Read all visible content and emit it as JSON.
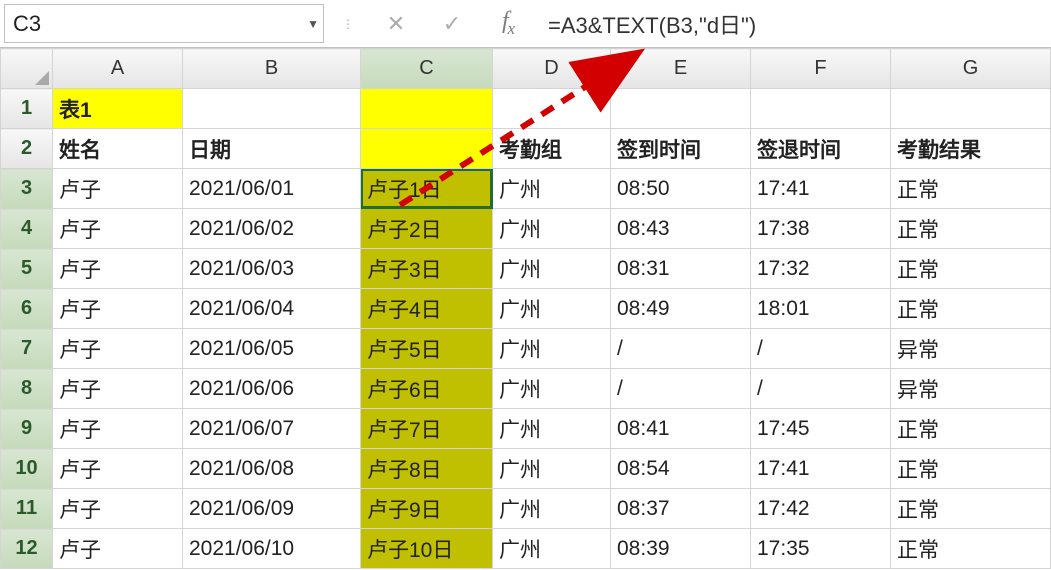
{
  "name_box": "C3",
  "formula": "=A3&TEXT(B3,\"d日\")",
  "col_headers": [
    "A",
    "B",
    "C",
    "D",
    "E",
    "F",
    "G"
  ],
  "selected_col_index": 2,
  "selected_row_indices": [
    3,
    4,
    5,
    6,
    7,
    8,
    9,
    10,
    11,
    12
  ],
  "rows": [
    {
      "n": 1,
      "cells": [
        "表1",
        "",
        "",
        "",
        "",
        "",
        ""
      ]
    },
    {
      "n": 2,
      "cells": [
        "姓名",
        "日期",
        "",
        "考勤组",
        "签到时间",
        "签退时间",
        "考勤结果"
      ]
    },
    {
      "n": 3,
      "cells": [
        "卢子",
        "2021/06/01",
        "卢子1日",
        "广州",
        "08:50",
        "17:41",
        "正常"
      ]
    },
    {
      "n": 4,
      "cells": [
        "卢子",
        "2021/06/02",
        "卢子2日",
        "广州",
        "08:43",
        "17:38",
        "正常"
      ]
    },
    {
      "n": 5,
      "cells": [
        "卢子",
        "2021/06/03",
        "卢子3日",
        "广州",
        "08:31",
        "17:32",
        "正常"
      ]
    },
    {
      "n": 6,
      "cells": [
        "卢子",
        "2021/06/04",
        "卢子4日",
        "广州",
        "08:49",
        "18:01",
        "正常"
      ]
    },
    {
      "n": 7,
      "cells": [
        "卢子",
        "2021/06/05",
        "卢子5日",
        "广州",
        "/",
        "/",
        "异常"
      ]
    },
    {
      "n": 8,
      "cells": [
        "卢子",
        "2021/06/06",
        "卢子6日",
        "广州",
        "/",
        "/",
        "异常"
      ]
    },
    {
      "n": 9,
      "cells": [
        "卢子",
        "2021/06/07",
        "卢子7日",
        "广州",
        "08:41",
        "17:45",
        "正常"
      ]
    },
    {
      "n": 10,
      "cells": [
        "卢子",
        "2021/06/08",
        "卢子8日",
        "广州",
        "08:54",
        "17:41",
        "正常"
      ]
    },
    {
      "n": 11,
      "cells": [
        "卢子",
        "2021/06/09",
        "卢子9日",
        "广州",
        "08:37",
        "17:42",
        "正常"
      ]
    },
    {
      "n": 12,
      "cells": [
        "卢子",
        "2021/06/10",
        "卢子10日",
        "广州",
        "08:39",
        "17:35",
        "正常"
      ]
    }
  ],
  "style_map": {
    "1": {
      "0": "hl-yellow hdr",
      "2": "hl-yellow"
    },
    "2": {
      "0": "hdr",
      "1": "hdr",
      "2": "hl-yellow",
      "3": "hdr",
      "4": "hdr",
      "5": "hdr",
      "6": "hdr"
    },
    "3": {
      "2": "hl-olive selected-outline"
    },
    "4": {
      "2": "hl-olive"
    },
    "5": {
      "2": "hl-olive"
    },
    "6": {
      "2": "hl-olive"
    },
    "7": {
      "2": "hl-olive"
    },
    "8": {
      "2": "hl-olive"
    },
    "9": {
      "2": "hl-olive"
    },
    "10": {
      "2": "hl-olive"
    },
    "11": {
      "2": "hl-olive"
    },
    "12": {
      "2": "hl-olive"
    }
  }
}
